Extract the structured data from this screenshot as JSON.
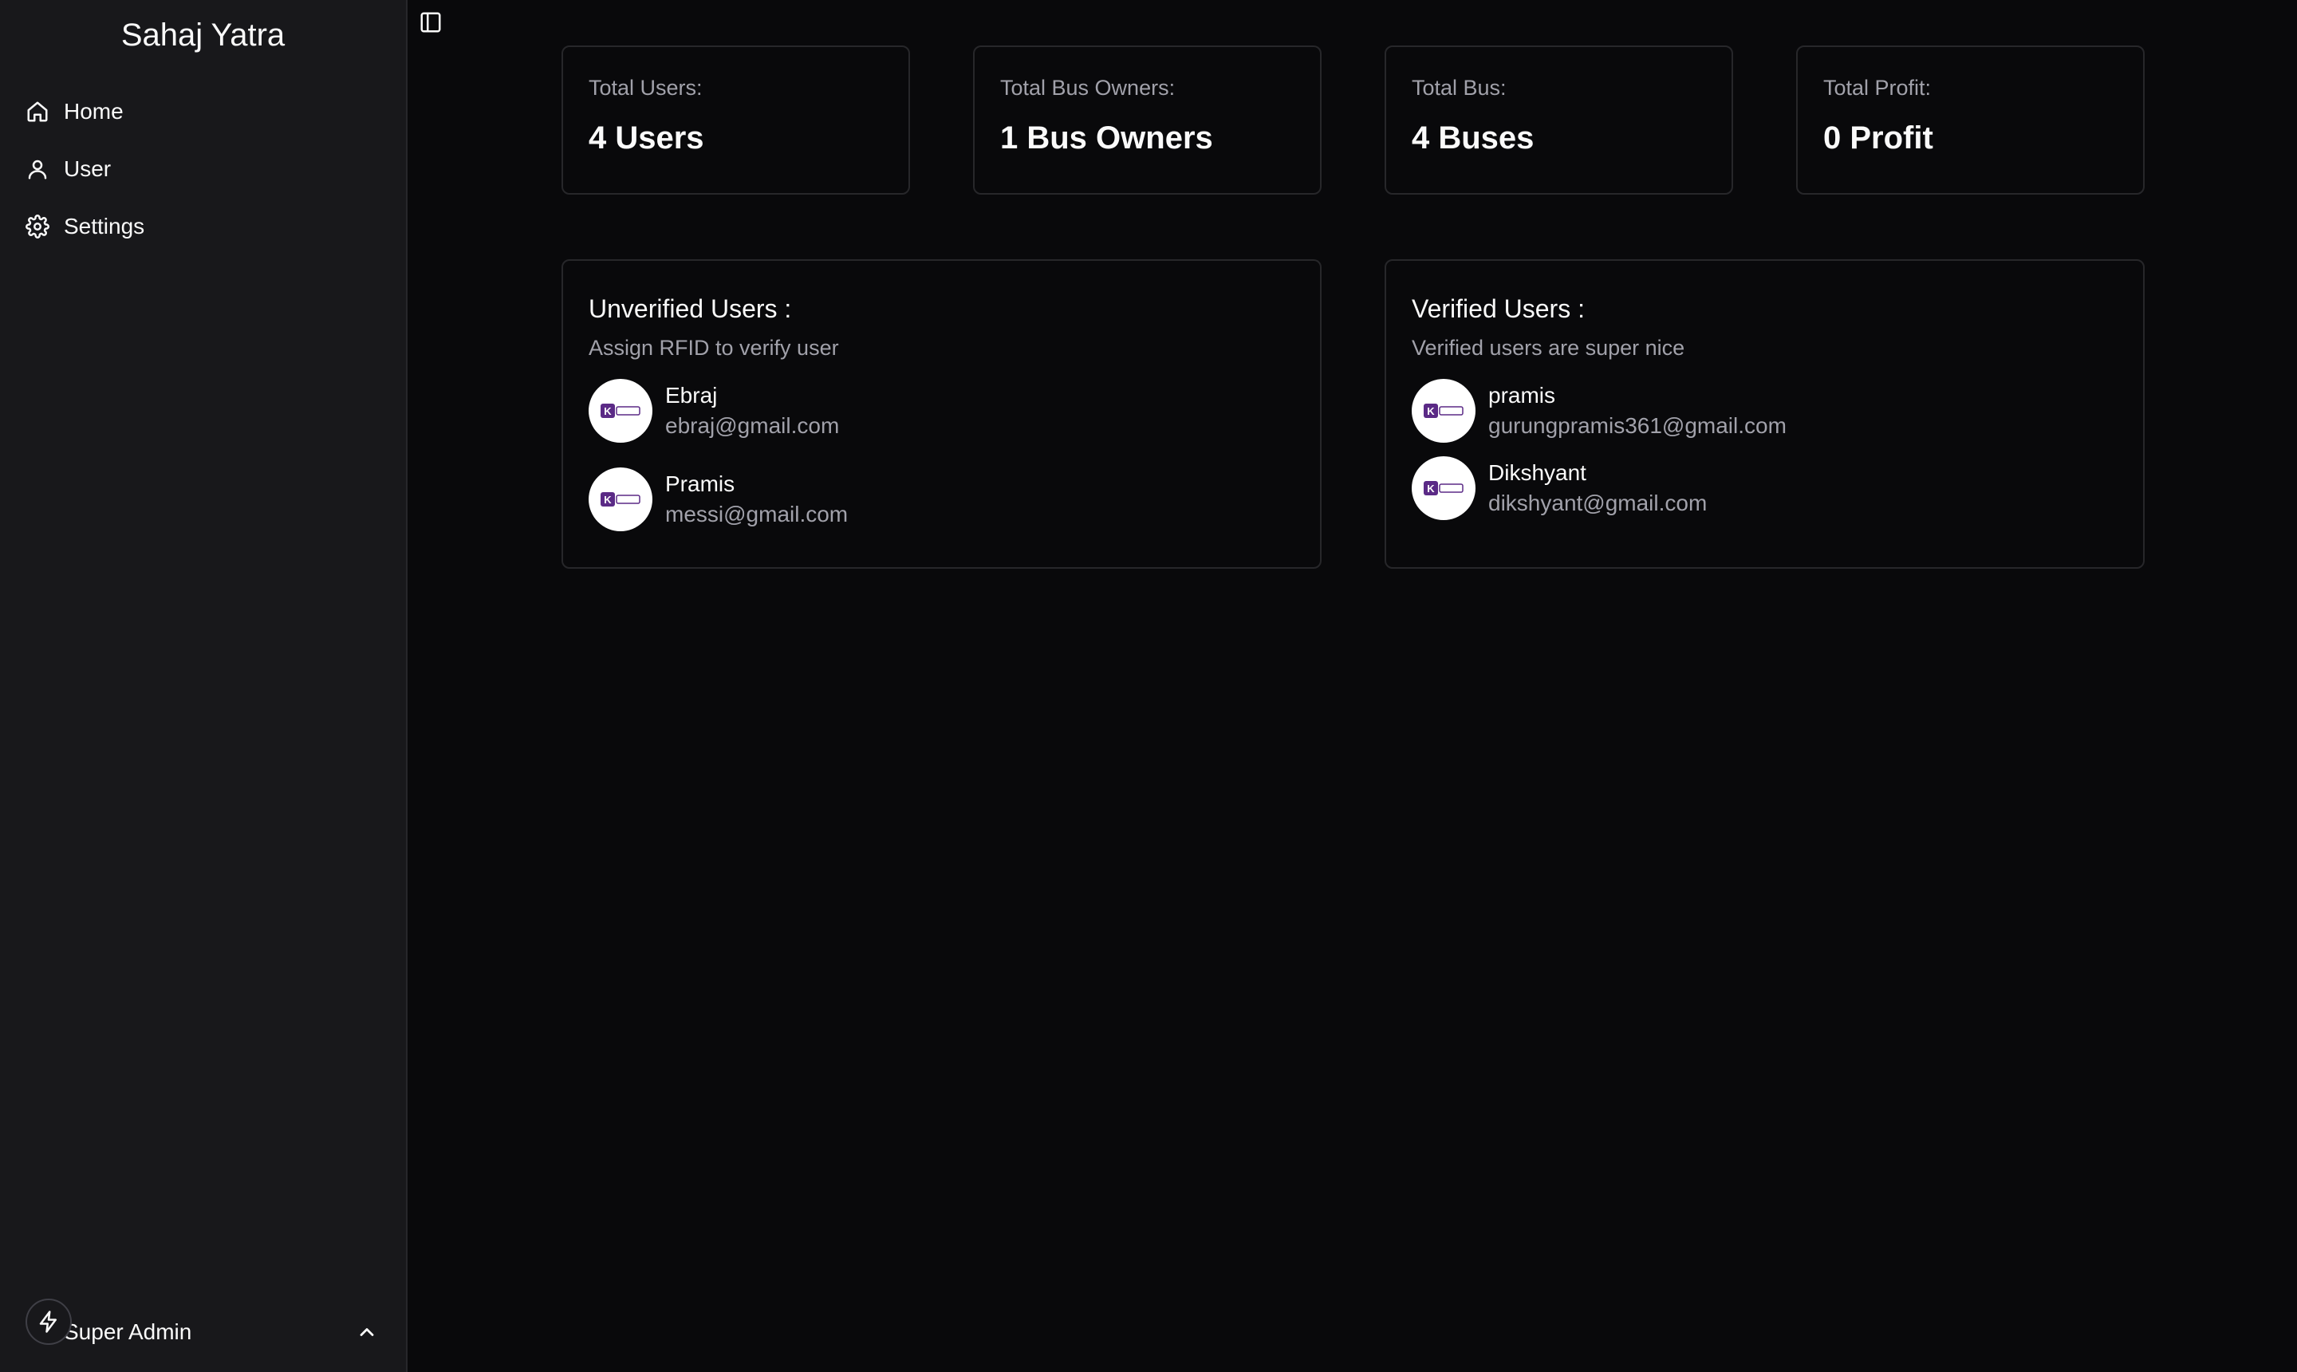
{
  "sidebar": {
    "brand": "Sahaj Yatra",
    "items": [
      {
        "label": "Home",
        "icon": "home-icon"
      },
      {
        "label": "User",
        "icon": "user-icon"
      },
      {
        "label": "Settings",
        "icon": "gear-icon"
      }
    ],
    "footer": {
      "label": "Super Admin",
      "icon": "chevron-up-icon"
    }
  },
  "stats": [
    {
      "label": "Total Users:",
      "value": "4 Users"
    },
    {
      "label": "Total Bus Owners:",
      "value": "1 Bus Owners"
    },
    {
      "label": "Total Bus:",
      "value": "4 Buses"
    },
    {
      "label": "Total Profit:",
      "value": "0 Profit"
    }
  ],
  "unverified": {
    "title": "Unverified Users :",
    "subtitle": "Assign RFID to verify user",
    "users": [
      {
        "name": "Ebraj",
        "email": "ebraj@gmail.com"
      },
      {
        "name": "Pramis",
        "email": "messi@gmail.com"
      }
    ]
  },
  "verified": {
    "title": "Verified Users :",
    "subtitle": "Verified users are super nice",
    "users": [
      {
        "name": "pramis",
        "email": "gurungpramis361@gmail.com"
      },
      {
        "name": "Dikshyant",
        "email": "dikshyant@gmail.com"
      }
    ]
  },
  "colors": {
    "background": "#09090b",
    "sidebar": "#18181b",
    "border": "#27272a",
    "muted_text": "#a1a1aa",
    "avatar_accent": "#5b2a86"
  }
}
